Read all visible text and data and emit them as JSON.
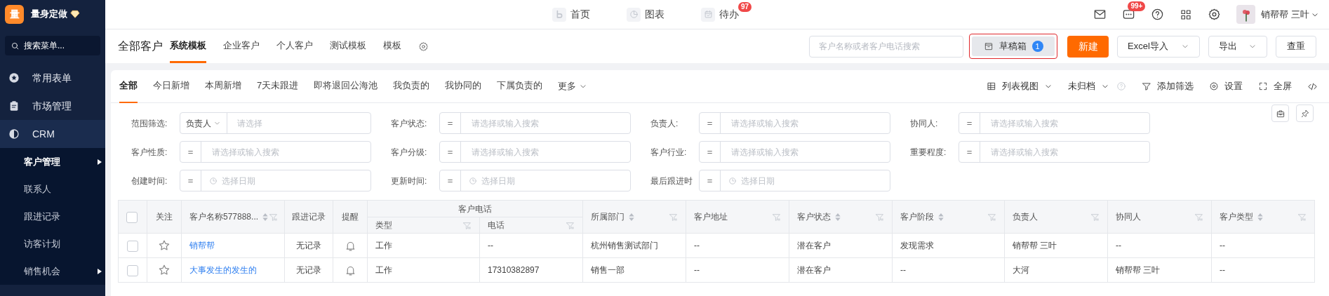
{
  "sidebar": {
    "logo": "量",
    "brand": "量身定做",
    "search_placeholder": "搜索菜单...",
    "items": [
      {
        "label": "常用表单",
        "expanded": false
      },
      {
        "label": "市场管理",
        "expanded": false
      },
      {
        "label": "CRM",
        "expanded": true,
        "children": [
          {
            "label": "客户管理",
            "selected": true,
            "submenu": true
          },
          {
            "label": "联系人",
            "selected": false,
            "submenu": false
          },
          {
            "label": "跟进记录",
            "selected": false,
            "submenu": false
          },
          {
            "label": "访客计划",
            "selected": false,
            "submenu": false
          },
          {
            "label": "销售机会",
            "selected": false,
            "submenu": true
          }
        ]
      }
    ]
  },
  "top_nav": [
    {
      "label": "首页"
    },
    {
      "label": "图表"
    },
    {
      "label": "待办",
      "badge": "97"
    }
  ],
  "top_right": {
    "message_badge": "99+",
    "user": "销帮帮 三叶"
  },
  "header": {
    "title": "全部客户",
    "tabs": [
      {
        "label": "系统模板",
        "selected": true
      },
      {
        "label": "企业客户",
        "selected": false
      },
      {
        "label": "个人客户",
        "selected": false
      },
      {
        "label": "测试模板",
        "selected": false
      },
      {
        "label": "模板",
        "selected": false
      }
    ],
    "search_placeholder": "客户名称或者客户电话搜索",
    "draft": {
      "label": "草稿箱",
      "count": "1",
      "highlighted": true
    },
    "new_button": "新建",
    "import_button": "Excel导入",
    "export_button": "导出",
    "dedupe_button": "查重"
  },
  "filter_tabs": [
    {
      "label": "全部",
      "selected": true
    },
    {
      "label": "今日新增",
      "selected": false
    },
    {
      "label": "本周新增",
      "selected": false
    },
    {
      "label": "7天未跟进",
      "selected": false
    },
    {
      "label": "即将退回公海池",
      "selected": false
    },
    {
      "label": "我负责的",
      "selected": false
    },
    {
      "label": "我协同的",
      "selected": false
    },
    {
      "label": "下属负责的",
      "selected": false
    }
  ],
  "more_tab": "更多",
  "toolbar": [
    {
      "kind": "view",
      "label": "列表视图"
    },
    {
      "kind": "archive",
      "label": "未归档"
    },
    {
      "kind": "filter",
      "label": "添加筛选"
    },
    {
      "kind": "settings",
      "label": "设置"
    },
    {
      "kind": "fullscreen",
      "label": "全屏"
    },
    {
      "kind": "code"
    }
  ],
  "filters": [
    {
      "kind": "scope",
      "label": "范围筛选:",
      "scope": "负责人",
      "placeholder": "请选择"
    },
    {
      "kind": "select",
      "label": "客户状态:",
      "operator": "=",
      "placeholder": "请选择或输入搜索"
    },
    {
      "kind": "select",
      "label": "负责人:",
      "operator": "=",
      "placeholder": "请选择或输入搜索"
    },
    {
      "kind": "select",
      "label": "协同人:",
      "operator": "=",
      "placeholder": "请选择或输入搜索"
    },
    {
      "kind": "select",
      "label": "客户性质:",
      "operator": "=",
      "placeholder": "请选择或输入搜索"
    },
    {
      "kind": "select",
      "label": "客户分级:",
      "operator": "=",
      "placeholder": "请选择或输入搜索"
    },
    {
      "kind": "select",
      "label": "客户行业:",
      "operator": "=",
      "placeholder": "请选择或输入搜索"
    },
    {
      "kind": "select",
      "label": "重要程度:",
      "operator": "=",
      "placeholder": "请选择或输入搜索"
    },
    {
      "kind": "date",
      "label": "创建时间:",
      "operator": "=",
      "placeholder": "选择日期"
    },
    {
      "kind": "date",
      "label": "更新时间:",
      "operator": "=",
      "placeholder": "选择日期"
    },
    {
      "kind": "date",
      "label": "最后跟进时",
      "operator": "=",
      "placeholder": "选择日期"
    }
  ],
  "table": {
    "all_checked": false,
    "columns": [
      {
        "label": "关注",
        "kind": "follow",
        "sortable": false,
        "filterable": false
      },
      {
        "label": "客户名称577888...",
        "kind": "link",
        "sortable": true,
        "filterable": true
      },
      {
        "label": "跟进记录",
        "kind": "center",
        "sortable": false,
        "filterable": false
      },
      {
        "label": "提醒",
        "kind": "reminder",
        "sortable": false,
        "filterable": false
      },
      {
        "label": "客户电话",
        "colspan": 2,
        "children": [
          {
            "label": "类型",
            "sortable": false,
            "filterable": true
          },
          {
            "label": "电话",
            "sortable": false,
            "filterable": true
          }
        ]
      },
      {
        "label": "所属部门",
        "sortable": true,
        "filterable": true
      },
      {
        "label": "客户地址",
        "sortable": false,
        "filterable": true
      },
      {
        "label": "客户状态",
        "sortable": true,
        "filterable": true
      },
      {
        "label": "客户阶段",
        "sortable": true,
        "filterable": true
      },
      {
        "label": "负责人",
        "sortable": false,
        "filterable": true
      },
      {
        "label": "协同人",
        "sortable": false,
        "filterable": true
      },
      {
        "label": "客户类型",
        "sortable": true,
        "filterable": true
      }
    ],
    "rows": [
      {
        "checked": false,
        "followed": false,
        "cells": [
          "",
          "销帮帮",
          "无记录",
          "",
          "工作",
          "--",
          "杭州销售测试部门",
          "--",
          "潜在客户",
          "发现需求",
          "销帮帮 三叶",
          "--",
          "--"
        ]
      },
      {
        "checked": false,
        "followed": false,
        "cells": [
          "",
          "大事发生的发生的",
          "无记录",
          "",
          "工作",
          "17310382897",
          "销售一部",
          "--",
          "潜在客户",
          "--",
          "大河",
          "销帮帮 三叶",
          "--"
        ]
      }
    ]
  }
}
